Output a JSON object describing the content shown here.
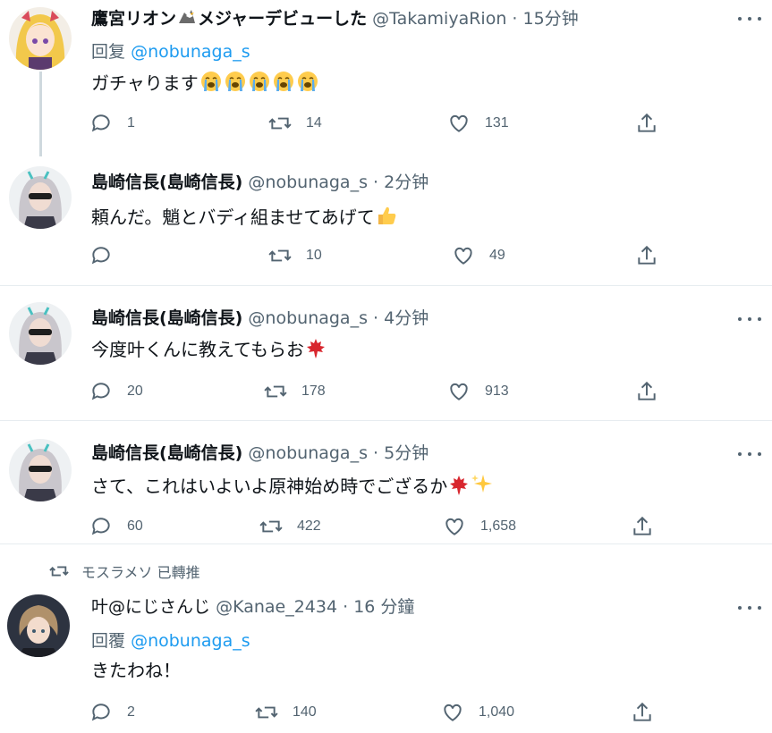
{
  "tweets": [
    {
      "name": "鷹宮リオン",
      "name_suffix": "メジャーデビューした",
      "handle": "@TakamiyaRion",
      "time": "15分钟",
      "reply_label": "回复",
      "reply_to": "@nobunaga_s",
      "text": "ガチャります",
      "emojis": [
        "loudly-crying-face",
        "loudly-crying-face",
        "loudly-crying-face",
        "loudly-crying-face",
        "loudly-crying-face"
      ],
      "replies": "1",
      "retweets": "14",
      "likes": "131"
    },
    {
      "name": "島崎信長(島崎信長)",
      "handle": "@nobunaga_s",
      "time": "2分钟",
      "text": "頼んだ。魈とバディ組ませてあげて",
      "emojis": [
        "thumbs-up"
      ],
      "replies": "",
      "retweets": "10",
      "likes": "49"
    },
    {
      "name": "島崎信長(島崎信長)",
      "handle": "@nobunaga_s",
      "time": "4分钟",
      "text": "今度叶くんに教えてもらお",
      "emojis": [
        "maple-leaf"
      ],
      "replies": "20",
      "retweets": "178",
      "likes": "913"
    },
    {
      "name": "島崎信長(島崎信長)",
      "handle": "@nobunaga_s",
      "time": "5分钟",
      "text": "さて、これはいよいよ原神始め時でござるか",
      "emojis": [
        "maple-leaf",
        "sparkles"
      ],
      "replies": "60",
      "retweets": "422",
      "likes": "1,658"
    },
    {
      "retweeted_by": "モスラメソ 已轉推",
      "name": "叶@にじさんじ",
      "handle": "@Kanae_2434",
      "time": "16 分鐘",
      "reply_label": "回覆",
      "reply_to": "@nobunaga_s",
      "text": "きたわね！",
      "emojis": [],
      "replies": "2",
      "retweets": "140",
      "likes": "1,040"
    }
  ],
  "colors": {
    "mention": "#1d9bf0",
    "secondary": "#536471",
    "divider": "#e6ecf0"
  }
}
